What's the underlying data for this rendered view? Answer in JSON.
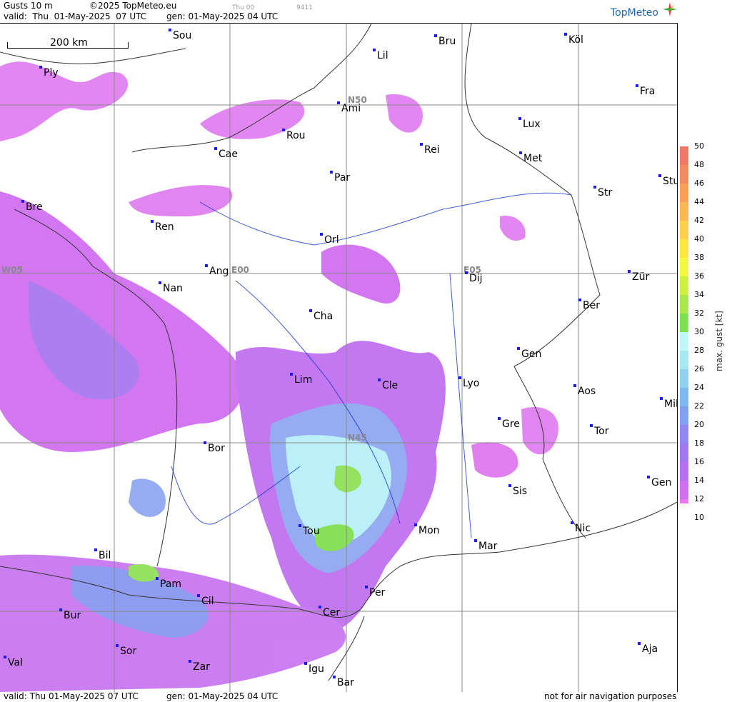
{
  "header": {
    "product": "Gusts 10 m",
    "copyright": "©2025 TopMeteo.eu",
    "day": "Thu 00",
    "code": "9411",
    "valid_line": "valid:  Thu  01-May-2025  07 UTC",
    "gen_line": "gen: 01-May-2025 04 UTC",
    "logo": "TopMeteo"
  },
  "footer": {
    "valid_line": "valid:  Thu  01-May-2025  07 UTC",
    "gen_line": "gen: 01-May-2025 04 UTC",
    "note": "not for air navigation purposes"
  },
  "scale": {
    "label": "200 km"
  },
  "grid_labels": [
    "N50",
    "N45",
    "E00",
    "E05",
    "W05"
  ],
  "cities": [
    "Sou",
    "Bru",
    "Köl",
    "Ply",
    "Lil",
    "Fra",
    "Ami",
    "Lux",
    "Rou",
    "Rei",
    "Cae",
    "Met",
    "Par",
    "Stu",
    "Bre",
    "Str",
    "Ren",
    "Orl",
    "Ang",
    "Dij",
    "Zür",
    "Nan",
    "Ber",
    "Cha",
    "Gen",
    "Lim",
    "Cle",
    "Lyo",
    "Aos",
    "Mil",
    "Gre",
    "Tor",
    "Bor",
    "Gen",
    "Sis",
    "Nic",
    "Tou",
    "Mon",
    "Mar",
    "Bil",
    "Pam",
    "Cil",
    "Per",
    "Cer",
    "Bur",
    "Aja",
    "Sor",
    "Val",
    "Zar",
    "Igu",
    "Bar"
  ],
  "legend": {
    "title": "max. gust [kt]",
    "ticks": [
      "50",
      "48",
      "46",
      "44",
      "42",
      "40",
      "38",
      "36",
      "34",
      "32",
      "30",
      "28",
      "26",
      "24",
      "22",
      "20",
      "18",
      "16",
      "14",
      "12",
      "10"
    ],
    "colors": [
      "#f07868",
      "#f48a60",
      "#f8a058",
      "#fcb850",
      "#fcd048",
      "#fce840",
      "#f4f840",
      "#d0f040",
      "#a8e848",
      "#80e050",
      "#c0f8f8",
      "#a8e8f0",
      "#90d0f0",
      "#80b8f0",
      "#80a0f0",
      "#9088f0",
      "#a078f0",
      "#b870f0",
      "#d070f0",
      "#e878f0"
    ]
  },
  "colors": {
    "accent": "#2266aa",
    "city_marker": "#1a1aff"
  }
}
